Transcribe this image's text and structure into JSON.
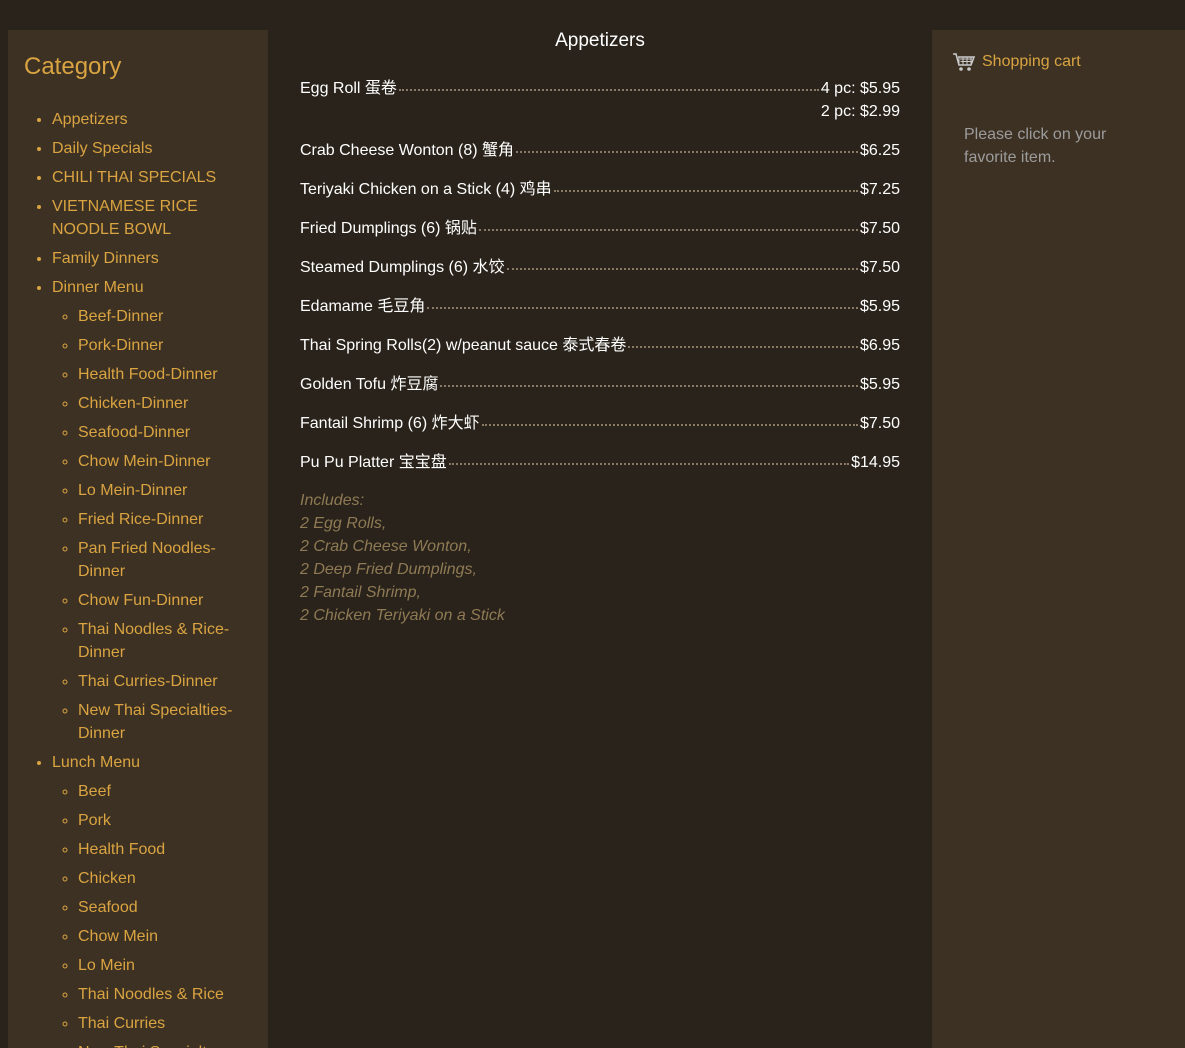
{
  "sidebar": {
    "title": "Category",
    "items": [
      {
        "label": "Appetizers"
      },
      {
        "label": "Daily Specials"
      },
      {
        "label": "CHILI THAI SPECIALS"
      },
      {
        "label": "VIETNAMESE RICE NOODLE BOWL"
      },
      {
        "label": "Family Dinners"
      },
      {
        "label": "Dinner Menu",
        "children": [
          "Beef-Dinner",
          "Pork-Dinner",
          "Health Food-Dinner",
          "Chicken-Dinner",
          "Seafood-Dinner",
          "Chow Mein-Dinner",
          "Lo Mein-Dinner",
          "Fried Rice-Dinner",
          "Pan Fried Noodles-Dinner",
          "Chow Fun-Dinner",
          "Thai Noodles & Rice-Dinner",
          "Thai Curries-Dinner",
          "New Thai Specialties-Dinner"
        ]
      },
      {
        "label": "Lunch Menu",
        "children": [
          "Beef",
          "Pork",
          "Health Food",
          "Chicken",
          "Seafood",
          "Chow Mein",
          "Lo Mein",
          "Thai Noodles & Rice",
          "Thai Curries",
          "New Thai Specialty"
        ]
      }
    ]
  },
  "main": {
    "title": "Appetizers",
    "items": [
      {
        "name": "Egg Roll 蛋卷",
        "prices": [
          "4 pc: $5.95",
          "2 pc: $2.99"
        ]
      },
      {
        "name": "Crab Cheese Wonton (8) 蟹角",
        "prices": [
          "$6.25"
        ]
      },
      {
        "name": "Teriyaki Chicken on a Stick (4) 鸡串",
        "prices": [
          "$7.25"
        ]
      },
      {
        "name": "Fried Dumplings (6) 锅贴",
        "prices": [
          "$7.50"
        ]
      },
      {
        "name": "Steamed Dumplings (6) 水饺",
        "prices": [
          "$7.50"
        ]
      },
      {
        "name": "Edamame 毛豆角",
        "prices": [
          "$5.95"
        ]
      },
      {
        "name": "Thai Spring Rolls(2) w/peanut sauce 泰式春卷",
        "prices": [
          "$6.95"
        ]
      },
      {
        "name": "Golden Tofu 炸豆腐",
        "prices": [
          "$5.95"
        ]
      },
      {
        "name": "Fantail Shrimp (6) 炸大虾",
        "prices": [
          "$7.50"
        ]
      },
      {
        "name": "Pu Pu Platter 宝宝盘",
        "prices": [
          "$14.95"
        ]
      }
    ],
    "includes": [
      "Includes:",
      "2 Egg Rolls,",
      "2 Crab Cheese Wonton,",
      "2 Deep Fried Dumplings,",
      "2 Fantail Shrimp,",
      "2 Chicken Teriyaki on a Stick"
    ]
  },
  "cart": {
    "icon": "shopping-cart-icon",
    "label": "Shopping cart",
    "message": "Please click on your favorite item."
  },
  "colors": {
    "accent": "#d9a441",
    "panel": "#3d3123",
    "background": "#2a231b"
  }
}
